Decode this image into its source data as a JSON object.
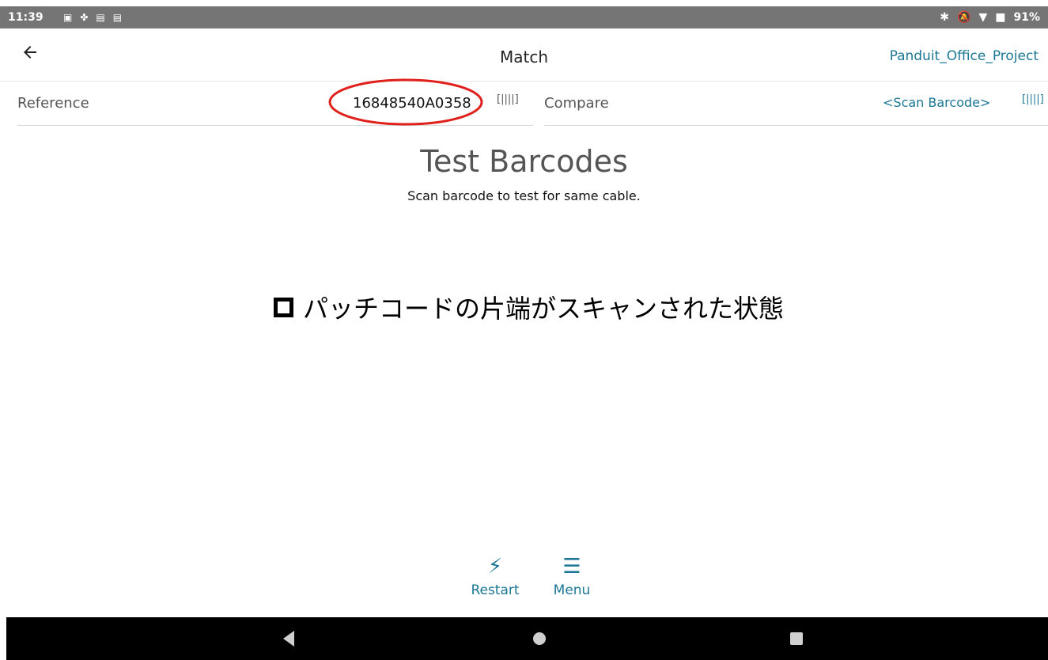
{
  "statusbar": {
    "time": "11:39",
    "battery": "91%"
  },
  "header": {
    "title": "Match",
    "project": "Panduit_Office_Project"
  },
  "reference": {
    "label": "Reference",
    "value": "16848540A0358",
    "scan_icon": "barcode-scan-icon"
  },
  "compare": {
    "label": "Compare",
    "value": "<Scan Barcode>",
    "scan_icon": "barcode-scan-icon"
  },
  "main": {
    "heading": "Test Barcodes",
    "subtitle": "Scan barcode to test for same cable."
  },
  "annotation": {
    "text": "パッチコードの片端がスキャンされた状態"
  },
  "actions": {
    "restart": "Restart",
    "menu": "Menu"
  },
  "colors": {
    "accent": "#1b7794",
    "annotation_ellipse": "#e0201b"
  }
}
